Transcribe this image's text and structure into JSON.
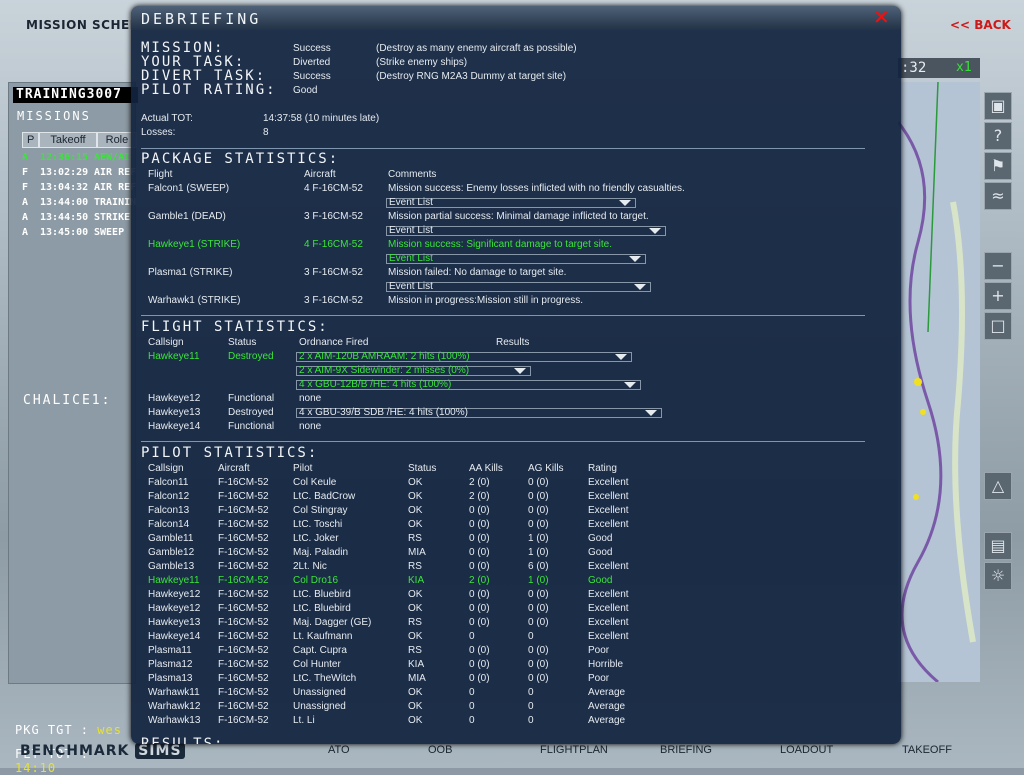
{
  "app": {
    "screen_title": "MISSION SCHEDULE",
    "back_label": "<< BACK",
    "clock": ":32",
    "zoom": "x1"
  },
  "left_panel": {
    "title": "TRAINING3007",
    "missions_label": "MISSIONS",
    "columns": [
      "P",
      "Takeoff",
      "Role"
    ],
    "rows": [
      {
        "p": "A",
        "takeoff": "12:36:15",
        "role": "AEW/AI"
      },
      {
        "p": "F",
        "takeoff": "13:02:29",
        "role": "AIR REF"
      },
      {
        "p": "F",
        "takeoff": "13:04:32",
        "role": "AIR REF"
      },
      {
        "p": "A",
        "takeoff": "13:44:00",
        "role": "TRAININ"
      },
      {
        "p": "A",
        "takeoff": "13:44:50",
        "role": "STRIKE"
      },
      {
        "p": "A",
        "takeoff": "13:45:00",
        "role": "SWEEP"
      }
    ],
    "chalice": "CHALICE1:",
    "pkg_tgt_label": "PKG TGT :",
    "pkg_tgt_value": "wes",
    "flt_tot_label": "FLT TOT :",
    "flt_tot_value": "14:10"
  },
  "debrief": {
    "title": "DEBRIEFING",
    "close": "✕",
    "summary": {
      "mission_label": "MISSION:",
      "mission_status": "Success",
      "mission_desc": "(Destroy as many enemy aircraft as possible)",
      "task_label": "YOUR TASK:",
      "task_status": "Diverted",
      "task_desc": "(Strike enemy ships)",
      "divert_label": "DIVERT TASK:",
      "divert_status": "Success",
      "divert_desc": "(Destroy RNG M2A3 Dummy at target site)",
      "rating_label": "PILOT RATING:",
      "rating_value": "Good",
      "tot_label": "Actual TOT:",
      "tot_value": "14:37:58 (10 minutes late)",
      "losses_label": "Losses:",
      "losses_value": "8"
    },
    "package": {
      "title": "PACKAGE STATISTICS:",
      "headers": [
        "Flight",
        "Aircraft",
        "Comments"
      ],
      "event_list_label": "Event List",
      "rows": [
        {
          "flight": "Falcon1 (SWEEP)",
          "aircraft": "4 F-16CM-52",
          "comment": "Mission success: Enemy losses inflicted with no friendly casualties.",
          "event": true
        },
        {
          "flight": "Gamble1 (DEAD)",
          "aircraft": "3 F-16CM-52",
          "comment": "Mission partial success: Minimal damage inflicted to target.",
          "event": true
        },
        {
          "flight": "Hawkeye1 (STRIKE)",
          "aircraft": "4 F-16CM-52",
          "comment": "Mission success: Significant damage to target site.",
          "event": true,
          "highlight": true
        },
        {
          "flight": "Plasma1 (STRIKE)",
          "aircraft": "3 F-16CM-52",
          "comment": "Mission failed: No damage to target site.",
          "event": true
        },
        {
          "flight": "Warhawk1 (STRIKE)",
          "aircraft": "3 F-16CM-52",
          "comment": "Mission in progress:Mission still in progress.",
          "event": false
        }
      ]
    },
    "flight": {
      "title": "FLIGHT STATISTICS:",
      "headers": [
        "Callsign",
        "Status",
        "Ordnance Fired",
        "Results"
      ],
      "rows": [
        {
          "callsign": "Hawkeye11",
          "status": "Destroyed",
          "ordnance": "2 x AIM-120B AMRAAM: 2 hits (100%)",
          "highlight": true,
          "dd": true
        },
        {
          "callsign": "",
          "status": "",
          "ordnance": "2 x AIM-9X Sidewinder: 2 misses (0%)",
          "highlight": true,
          "dd": true
        },
        {
          "callsign": "",
          "status": "",
          "ordnance": "4 x GBU-12B/B /HE: 4 hits (100%)",
          "highlight": true,
          "dd": true
        },
        {
          "callsign": "Hawkeye12",
          "status": "Functional",
          "ordnance": "none",
          "highlight": false,
          "dd": false
        },
        {
          "callsign": "Hawkeye13",
          "status": "Destroyed",
          "ordnance": "4 x GBU-39/B SDB /HE: 4 hits (100%)",
          "highlight": false,
          "dd": true
        },
        {
          "callsign": "Hawkeye14",
          "status": "Functional",
          "ordnance": "none",
          "highlight": false,
          "dd": false
        }
      ]
    },
    "pilot": {
      "title": "PILOT STATISTICS:",
      "headers": [
        "Callsign",
        "Aircraft",
        "Pilot",
        "Status",
        "AA Kills",
        "AG Kills",
        "Rating"
      ],
      "rows": [
        [
          "Falcon11",
          "F-16CM-52",
          "Col Keule",
          "OK",
          "2 (0)",
          "0 (0)",
          "Excellent"
        ],
        [
          "Falcon12",
          "F-16CM-52",
          "LtC. BadCrow",
          "OK",
          "2 (0)",
          "0 (0)",
          "Excellent"
        ],
        [
          "Falcon13",
          "F-16CM-52",
          "Col Stingray",
          "OK",
          "0 (0)",
          "0 (0)",
          "Excellent"
        ],
        [
          "Falcon14",
          "F-16CM-52",
          "LtC. Toschi",
          "OK",
          "0 (0)",
          "0 (0)",
          "Excellent"
        ],
        [
          "Gamble11",
          "F-16CM-52",
          "LtC. Joker",
          "RS",
          "0 (0)",
          "1 (0)",
          "Good"
        ],
        [
          "Gamble12",
          "F-16CM-52",
          "Maj. Paladin",
          "MIA",
          "0 (0)",
          "1 (0)",
          "Good"
        ],
        [
          "Gamble13",
          "F-16CM-52",
          "2Lt. Nic",
          "RS",
          "0 (0)",
          "6 (0)",
          "Excellent"
        ],
        [
          "Hawkeye11",
          "F-16CM-52",
          "Col Dro16",
          "KIA",
          "2 (0)",
          "1 (0)",
          "Good"
        ],
        [
          "Hawkeye12",
          "F-16CM-52",
          "LtC. Bluebird",
          "OK",
          "0 (0)",
          "0 (0)",
          "Excellent"
        ],
        [
          "Hawkeye12",
          "F-16CM-52",
          "LtC. Bluebird",
          "OK",
          "0 (0)",
          "0 (0)",
          "Excellent"
        ],
        [
          "Hawkeye13",
          "F-16CM-52",
          "Maj. Dagger (GE)",
          "RS",
          "0 (0)",
          "0 (0)",
          "Excellent"
        ],
        [
          "Hawkeye14",
          "F-16CM-52",
          "Lt. Kaufmann",
          "OK",
          "0",
          "0",
          "Excellent"
        ],
        [
          "Plasma11",
          "F-16CM-52",
          "Capt. Cupra",
          "RS",
          "0 (0)",
          "0 (0)",
          "Poor"
        ],
        [
          "Plasma12",
          "F-16CM-52",
          "Col Hunter",
          "KIA",
          "0 (0)",
          "0 (0)",
          "Horrible"
        ],
        [
          "Plasma13",
          "F-16CM-52",
          "LtC. TheWitch",
          "MIA",
          "0 (0)",
          "0 (0)",
          "Poor"
        ],
        [
          "Warhawk11",
          "F-16CM-52",
          "Unassigned",
          "OK",
          "0",
          "0",
          "Average"
        ],
        [
          "Warhawk12",
          "F-16CM-52",
          "Unassigned",
          "OK",
          "0",
          "0",
          "Average"
        ],
        [
          "Warhawk13",
          "F-16CM-52",
          "Lt. Li",
          "OK",
          "0",
          "0",
          "Average"
        ]
      ],
      "highlight_row": 7
    },
    "results_title": "RESULTS:"
  },
  "bottom_nav": {
    "logo_main": "BENCHMARK",
    "logo_sims": "SIMS",
    "items": [
      "ATO",
      "OOB",
      "FLIGHTPLAN",
      "BRIEFING",
      "LOADOUT",
      "TAKEOFF"
    ]
  },
  "colors": {
    "highlight": "#39e639",
    "close": "#e11111",
    "back": "#cc1a1a"
  },
  "icons": [
    "close-icon",
    "question-icon",
    "flag-icon",
    "weather-icon",
    "zoom-out-icon",
    "zoom-in-icon",
    "fit-icon",
    "chevron-down-icon"
  ]
}
